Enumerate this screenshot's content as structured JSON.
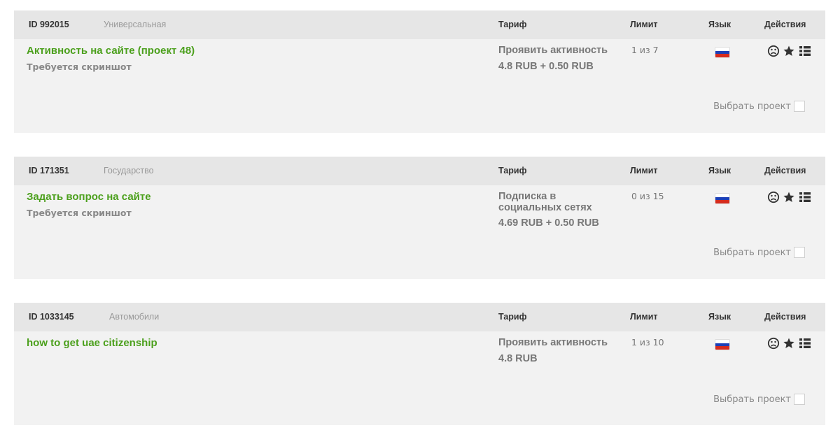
{
  "columns": {
    "tariff": "Тариф",
    "limit": "Лимит",
    "language": "Язык",
    "actions": "Действия"
  },
  "select_label": "Выбрать проект",
  "accent_color": "#4ca01d",
  "icons": [
    "sad-face-icon",
    "star-icon",
    "list-icon",
    "russia-flag-icon"
  ],
  "projects": [
    {
      "id": "ID 992015",
      "category": "Универсальная",
      "title": "Активность на сайте (проект 48)",
      "note": "Требуется скриншот",
      "tariff": "Проявить активность",
      "price": "4.8 RUB + 0.50 RUB",
      "limit": "1 из 7",
      "language": "ru"
    },
    {
      "id": "ID 171351",
      "category": "Государство",
      "title": "Задать вопрос на сайте",
      "note": "Требуется скриншот",
      "tariff": "Подписка в социальных сетях",
      "price": "4.69 RUB + 0.50 RUB",
      "limit": "0 из 15",
      "language": "ru"
    },
    {
      "id": "ID 1033145",
      "category": "Автомобили",
      "title": "how to get uae citizenship",
      "note": "",
      "tariff": "Проявить активность",
      "price": "4.8 RUB",
      "limit": "1 из 10",
      "language": "ru"
    }
  ]
}
